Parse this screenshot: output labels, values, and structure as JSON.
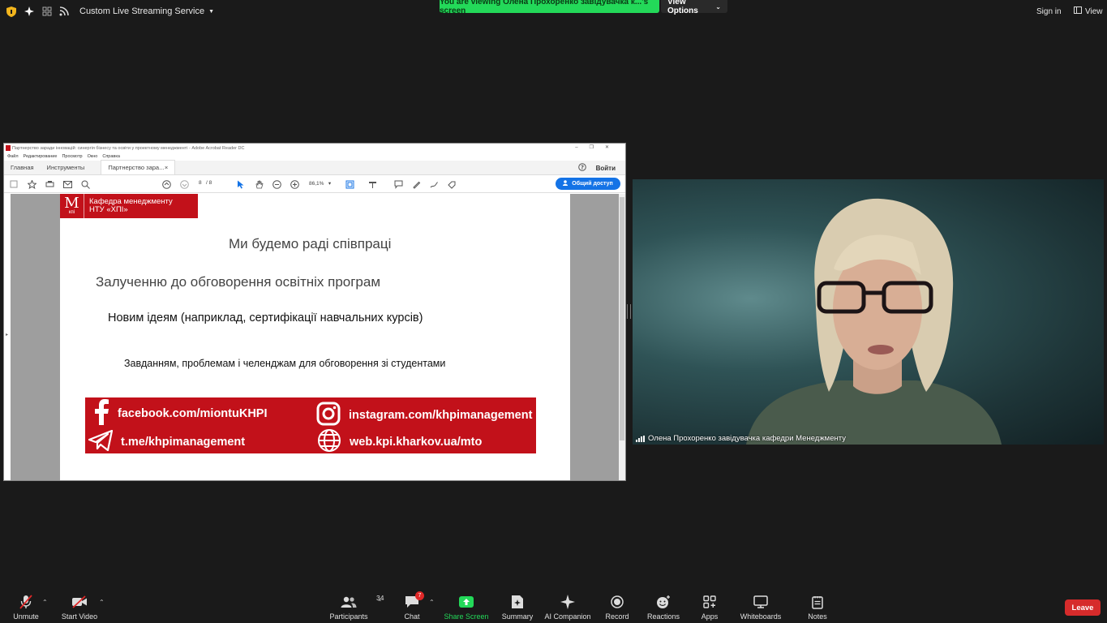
{
  "topbar": {
    "service_label": "Custom Live Streaming Service",
    "viewing_text": "You are viewing Олена Прохоренко завідувачка к...'s screen",
    "view_options_label": "View Options",
    "sign_in_label": "Sign in",
    "view_label": "View"
  },
  "acrobat": {
    "window_title": "Партнерство заради інновацій: синергія бізнесу та освіти у проектному менеджменті - Adobe Acrobat Reader DC",
    "menu": [
      "Файл",
      "Редактирование",
      "Просмотр",
      "Окно",
      "Справка"
    ],
    "tab_home": "Главная",
    "tab_tools": "Инструменты",
    "tab_doc": "Партнерство зара...",
    "login_label": "Войти",
    "page_current": "8",
    "page_total": "/ 8",
    "zoom": "86,1%",
    "share_label": "Общий доступ"
  },
  "slide": {
    "logo_mark": "М",
    "logo_sub": "кпі",
    "logo_line1": "Кафедра менеджменту",
    "logo_line2": "НТУ «ХПІ»",
    "line1": "Ми будемо раді співпраці",
    "line2": "Залученню до обговорення освітніх програм",
    "line3": "Новим ідеям (наприклад, сертифікації навчальних курсів)",
    "line4": "Завданням, проблемам і челенджам для обговорення зі студентами",
    "facebook": "facebook.com/miontuKHPI",
    "instagram": "instagram.com/khpimanagement",
    "telegram": "t.me/khpimanagement",
    "web": "web.kpi.kharkov.ua/mto"
  },
  "video": {
    "participant_name": "Олена Прохоренко завідувачка кафедри Менеджменту"
  },
  "toolbar": {
    "unmute": "Unmute",
    "start_video": "Start Video",
    "participants": "Participants",
    "participants_count": "34",
    "chat": "Chat",
    "chat_badge": "7",
    "share_screen": "Share Screen",
    "summary": "Summary",
    "ai_companion": "AI Companion",
    "record": "Record",
    "reactions": "Reactions",
    "apps": "Apps",
    "whiteboards": "Whiteboards",
    "notes": "Notes",
    "leave": "Leave"
  },
  "colors": {
    "accent_green": "#23d959",
    "brand_red": "#c2111a",
    "leave_red": "#d62b2b",
    "share_blue": "#1473e6"
  }
}
